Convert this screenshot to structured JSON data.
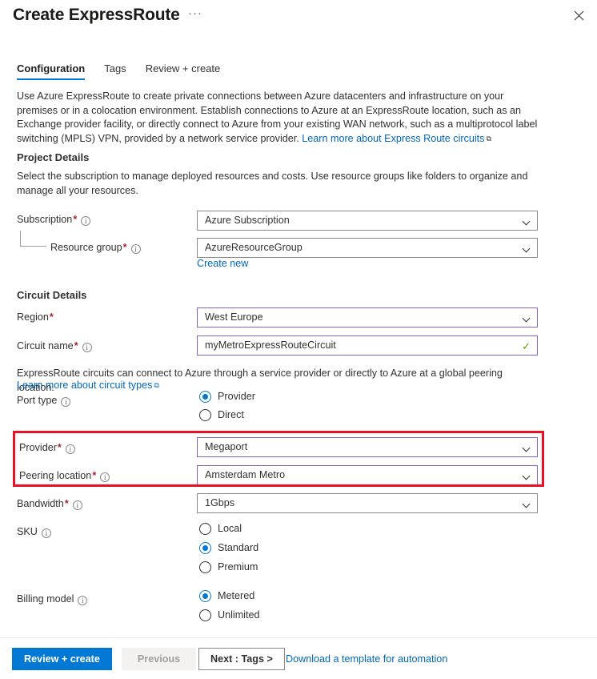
{
  "header": {
    "title": "Create ExpressRoute",
    "ellipsis": "···",
    "close_icon": "close-icon"
  },
  "tabs": [
    {
      "label": "Configuration",
      "active": true
    },
    {
      "label": "Tags",
      "active": false
    },
    {
      "label": "Review + create",
      "active": false
    }
  ],
  "intro": {
    "text": "Use Azure ExpressRoute to create private connections between Azure datacenters and infrastructure on your premises or in a colocation environment. Establish connections to Azure at an ExpressRoute location, such as an Exchange provider facility, or directly connect to Azure from your existing WAN network, such as a multiprotocol label switching (MPLS) VPN, provided by a network service provider. ",
    "link": "Learn more about Express Route circuits"
  },
  "project_details": {
    "heading": "Project Details",
    "description": "Select the subscription to manage deployed resources and costs. Use resource groups like folders to organize and manage all your resources.",
    "subscription": {
      "label": "Subscription",
      "required": "*",
      "value": "Azure Subscription"
    },
    "resource_group": {
      "label": "Resource group",
      "required": "*",
      "value": "AzureResourceGroup",
      "create_new": "Create new"
    }
  },
  "circuit_details": {
    "heading": "Circuit Details",
    "region": {
      "label": "Region",
      "required": "*",
      "value": "West Europe"
    },
    "circuit_name": {
      "label": "Circuit name",
      "required": "*",
      "value": "myMetroExpressRouteCircuit",
      "validation_icon": "check-icon"
    },
    "note": "ExpressRoute circuits can connect to Azure through a service provider or directly to Azure at a global peering location.",
    "note_link": "Learn more about circuit types",
    "port_type": {
      "label": "Port type",
      "options": [
        {
          "label": "Provider",
          "selected": true
        },
        {
          "label": "Direct",
          "selected": false
        }
      ]
    },
    "provider": {
      "label": "Provider",
      "required": "*",
      "value": "Megaport"
    },
    "peering_location": {
      "label": "Peering location",
      "required": "*",
      "value": "Amsterdam Metro"
    },
    "bandwidth": {
      "label": "Bandwidth",
      "required": "*",
      "value": "1Gbps"
    },
    "sku": {
      "label": "SKU",
      "options": [
        {
          "label": "Local",
          "selected": false
        },
        {
          "label": "Standard",
          "selected": true
        },
        {
          "label": "Premium",
          "selected": false
        }
      ]
    },
    "billing_model": {
      "label": "Billing model",
      "options": [
        {
          "label": "Metered",
          "selected": true
        },
        {
          "label": "Unlimited",
          "selected": false
        }
      ]
    }
  },
  "highlight": {
    "color": "#e81123",
    "targets": "provider-and-peering-location"
  },
  "footer": {
    "review_create": "Review + create",
    "previous": "Previous",
    "next": "Next : Tags >",
    "download_template": "Download a template for automation"
  },
  "colors": {
    "accent": "#0078d4",
    "link": "#0067b8",
    "modified_field_border": "#8661c5",
    "required_asterisk": "#a4262c",
    "highlight_red": "#e81123",
    "valid_check": "#5aa702"
  }
}
